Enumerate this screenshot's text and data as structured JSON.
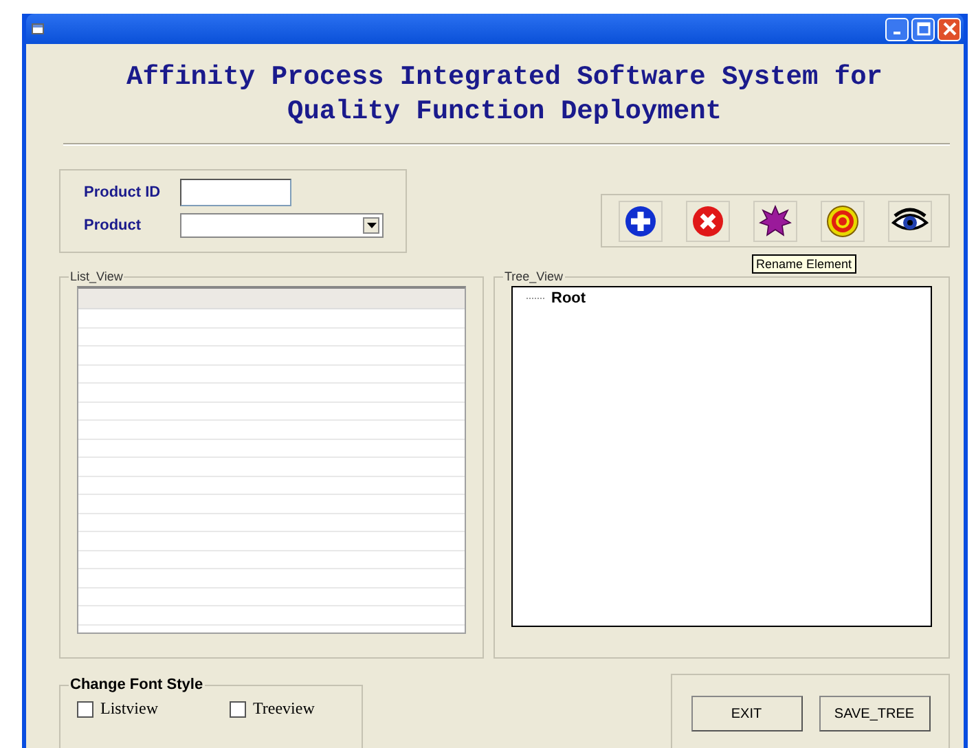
{
  "heading_lines": [
    "Affinity Process Integrated Software System for",
    "Quality Function Deployment"
  ],
  "product_group": {
    "fields": [
      {
        "label": "Product ID",
        "kind": "text"
      },
      {
        "label": "Product",
        "kind": "combo"
      }
    ]
  },
  "toolbar": [
    {
      "kind": "add"
    },
    {
      "kind": "delete"
    },
    {
      "kind": "star"
    },
    {
      "kind": "target"
    },
    {
      "kind": "eye"
    }
  ],
  "tooltip": "Rename Element",
  "list_view": {
    "title": "List_View"
  },
  "tree_view": {
    "title": "Tree_View",
    "items": [
      {
        "label": "Root"
      }
    ]
  },
  "font_style": {
    "title": "Change Font Style",
    "options": [
      {
        "label": "Listview",
        "checked": false
      },
      {
        "label": "Treeview",
        "checked": false
      }
    ]
  },
  "buttons": [
    "EXIT",
    "SAVE_TREE"
  ]
}
